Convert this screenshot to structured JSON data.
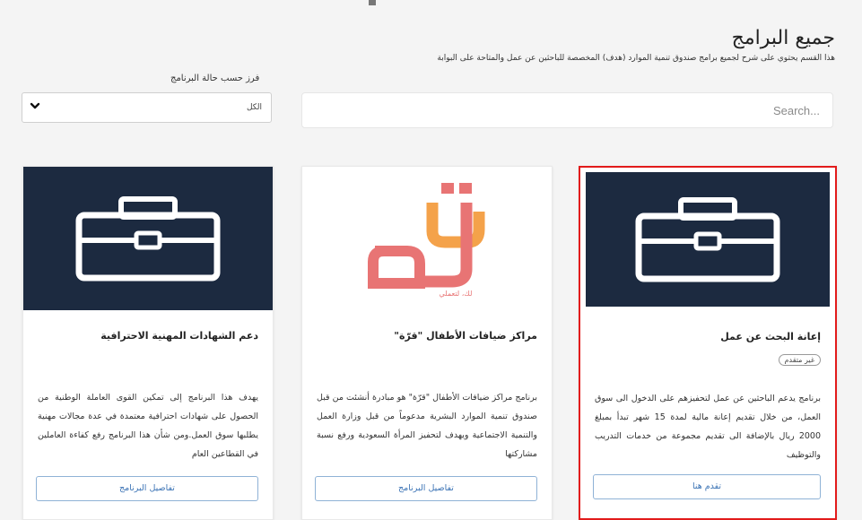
{
  "header": {
    "title": "جميع البرامج",
    "description": "هذا القسم يحتوي على شرح لجميع برامج صندوق تنمية الموارد (هدف) المخصصة للباحثين عن عمل والمتاحة على البوابة"
  },
  "filter": {
    "label": "فرز حسب حالة البرنامج",
    "selected": "الكل",
    "icon": "chevron-down-icon"
  },
  "search": {
    "placeholder": "Search..."
  },
  "colors": {
    "card_image_dark": "#1c2a40",
    "selected_border": "#e21b1b",
    "button_text": "#3b73b5",
    "logo_pink": "#e87474",
    "logo_orange": "#f4a24a"
  },
  "cards": [
    {
      "title": "إعانة البحث عن عمل",
      "badge": "غير متقدم",
      "description": "برنامج يدعم الباحثين عن عمل لتحفيزهم على الدخول الى سوق العمل، من خلال تقديم إعانة مالية لمدة 15 شهر تبدأ بمبلغ 2000 ريال بالإضافة الى تقديم مجموعة من خدمات التدريب والتوظيف",
      "button": "تقدم هنا",
      "icon": "briefcase-icon"
    },
    {
      "title": "مراكز ضيافات الأطفال \"قرّة\"",
      "description": "برنامج مراكز ضيافات الأطفال \"قرّة\" هو مبادرة أنشئت من قبل صندوق تنمية الموارد البشرية مدعوماً من قبل وزارة العمل والتنمية الاجتماعية ويهدف لتحفيز المرأة السعودية ورفع نسبة مشاركتها",
      "button": "تفاصيل البرنامج",
      "logo_text": "قرة",
      "logo_sub": "لك، لتعملي"
    },
    {
      "title": "دعم الشهادات المهنية الاحترافية",
      "description": "يهدف هذا البرنامج إلى تمكين القوى العاملة الوطنية من الحصول على شهادات احترافية معتمدة في عدة مجالات مهنية يطلبها سوق العمل.ومن شأن هذا البرنامج رفع كفاءة العاملين في القطاعين العام",
      "button": "تفاصيل البرنامج",
      "icon": "briefcase-icon"
    }
  ]
}
